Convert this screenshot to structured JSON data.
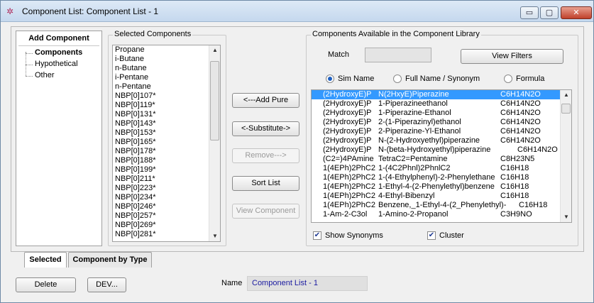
{
  "window": {
    "title": "Component List: Component List - 1",
    "controls": {
      "minimize": "▭",
      "maximize": "▢",
      "close": "✕"
    }
  },
  "add_component": {
    "header": "Add Component",
    "items": [
      "Components",
      "Hypothetical",
      "Other"
    ]
  },
  "selected_components": {
    "label": "Selected Components",
    "items": [
      "Propane",
      "i-Butane",
      "n-Butane",
      "i-Pentane",
      "n-Pentane",
      "NBP[0]107*",
      "NBP[0]119*",
      "NBP[0]131*",
      "NBP[0]143*",
      "NBP[0]153*",
      "NBP[0]165*",
      "NBP[0]178*",
      "NBP[0]188*",
      "NBP[0]199*",
      "NBP[0]211*",
      "NBP[0]223*",
      "NBP[0]234*",
      "NBP[0]246*",
      "NBP[0]257*",
      "NBP[0]269*",
      "NBP[0]281*"
    ]
  },
  "actions": {
    "add_pure": "<---Add Pure",
    "substitute": "<-Substitute->",
    "remove": "Remove--->",
    "sort_list": "Sort List",
    "view_component": "View Component"
  },
  "library": {
    "label": "Components Available in the Component Library",
    "match_label": "Match",
    "match_value": "",
    "view_filters": "View Filters",
    "radios": [
      {
        "label": "Sim Name",
        "selected": true
      },
      {
        "label": "Full Name / Synonym",
        "selected": false
      },
      {
        "label": "Formula",
        "selected": false
      }
    ],
    "rows": [
      {
        "sim": "(2HydroxyE)P",
        "full": "N(2HxyE)Piperazine",
        "formula": "C6H14N2O",
        "selected": true
      },
      {
        "sim": "(2HydroxyE)P",
        "full": "1-Piperazineethanol",
        "formula": "C6H14N2O",
        "selected": false
      },
      {
        "sim": "(2HydroxyE)P",
        "full": "1-Piperazine-Ethanol",
        "formula": "C6H14N2O",
        "selected": false
      },
      {
        "sim": "(2HydroxyE)P",
        "full": "2-(1-Piperazinyl)ethanol",
        "formula": "C6H14N2O",
        "selected": false
      },
      {
        "sim": "(2HydroxyE)P",
        "full": "2-Piperazine-Yl-Ethanol",
        "formula": "C6H14N2O",
        "selected": false
      },
      {
        "sim": "(2HydroxyE)P",
        "full": "N-(2-Hydroxyethyl)piperazine",
        "formula": "C6H14N2O",
        "selected": false
      },
      {
        "sim": "(2HydroxyE)P",
        "full": "N-(beta-Hydroxyethyl)piperazine",
        "formula": "C6H14N2O",
        "selected": false
      },
      {
        "sim": "(C2=)4PAmine",
        "full": "TetraC2=Pentamine",
        "formula": "C8H23N5",
        "selected": false
      },
      {
        "sim": "1(4EPh)2PhC2",
        "full": "1-(4C2Phnl)2PhnlC2",
        "formula": "C16H18",
        "selected": false
      },
      {
        "sim": "1(4EPh)2PhC2",
        "full": "1-(4-Ethylphenyl)-2-Phenylethane",
        "formula": "C16H18",
        "selected": false
      },
      {
        "sim": "1(4EPh)2PhC2",
        "full": "1-Ethyl-4-(2-Phenylethyl)benzene",
        "formula": "C16H18",
        "selected": false
      },
      {
        "sim": "1(4EPh)2PhC2",
        "full": "4-Ethyl-Bibenzyl",
        "formula": "C16H18",
        "selected": false
      },
      {
        "sim": "1(4EPh)2PhC2",
        "full": "Benzene,_1-Ethyl-4-(2_Phenylethyl)-",
        "formula": "C16H18",
        "selected": false
      },
      {
        "sim": "1-Am-2-C3ol",
        "full": "1-Amino-2-Propanol",
        "formula": "C3H9NO",
        "selected": false
      }
    ],
    "show_synonyms_label": "Show Synonyms",
    "show_synonyms": true,
    "cluster_label": "Cluster",
    "cluster": true
  },
  "tabs": [
    "Selected",
    "Component by Type"
  ],
  "footer": {
    "delete": "Delete",
    "dev": "DEV...",
    "name_label": "Name",
    "name_value": "Component List - 1"
  }
}
